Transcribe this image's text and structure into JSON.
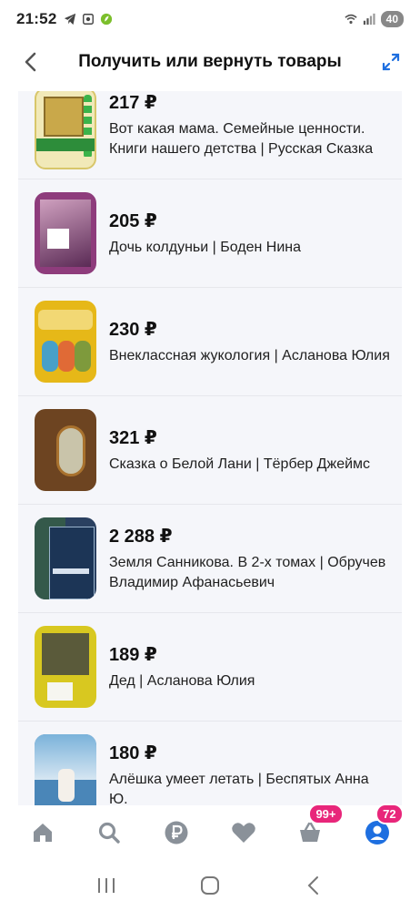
{
  "statusbar": {
    "time": "21:52",
    "battery": "40",
    "icons_left": [
      "telegram-icon",
      "screenshot-icon",
      "app-icon"
    ],
    "icons_right": [
      "wifi-icon",
      "signal-icon"
    ]
  },
  "header": {
    "title": "Получить или вернуть товары",
    "back_icon": "chevron-left-icon",
    "expand_icon": "expand-arrows-icon"
  },
  "items": [
    {
      "price": "217 ₽",
      "name": "Вот какая мама. Семейные ценности. Книги нашего детства | Русская Сказка"
    },
    {
      "price": "205 ₽",
      "name": "Дочь колдуньи | Боден Нина"
    },
    {
      "price": "230 ₽",
      "name": "Внеклассная жукология | Асланова Юлия"
    },
    {
      "price": "321 ₽",
      "name": "Сказка о Белой Лани | Тёрбер Джеймс"
    },
    {
      "price": "2 288 ₽",
      "name": "Земля Санникова. В 2-х томах | Обручев Владимир Афанасьевич"
    },
    {
      "price": "189 ₽",
      "name": "Дед | Асланова Юлия"
    },
    {
      "price": "180 ₽",
      "name": "Алёшка умеет летать | Беспятых Анна Ю."
    }
  ],
  "bottom_nav": {
    "items": [
      "home-icon",
      "search-icon",
      "ruble-icon",
      "heart-icon",
      "cart-icon",
      "profile-icon"
    ],
    "cart_badge": "99+",
    "profile_badge": "72"
  },
  "colors": {
    "accent": "#1e6fe0",
    "badge": "#e8267a",
    "list_bg": "#f5f6fa",
    "icon_gray": "#8a9199"
  }
}
